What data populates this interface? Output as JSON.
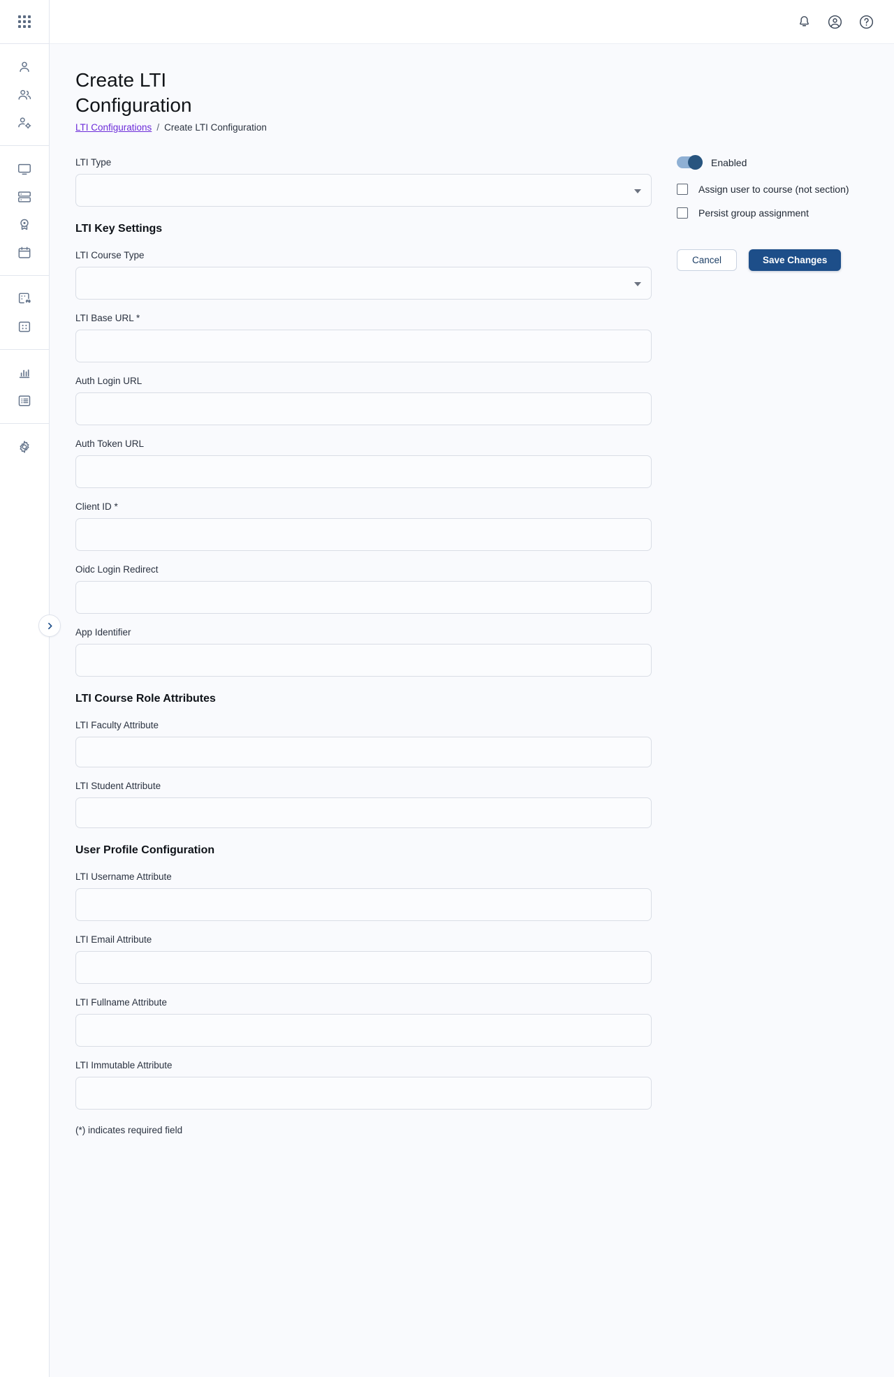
{
  "sidebar": {
    "logo_icon": "app-grid-icon",
    "groups": [
      {
        "items": [
          {
            "icon": "user-icon",
            "name": "sidebar-item-user"
          },
          {
            "icon": "users-group-icon",
            "name": "sidebar-item-groups"
          },
          {
            "icon": "user-settings-icon",
            "name": "sidebar-item-user-settings"
          }
        ]
      },
      {
        "items": [
          {
            "icon": "monitor-icon",
            "name": "sidebar-item-monitor"
          },
          {
            "icon": "server-icon",
            "name": "sidebar-item-server"
          },
          {
            "icon": "badge-award-icon",
            "name": "sidebar-item-badge"
          },
          {
            "icon": "calendar-icon",
            "name": "sidebar-item-calendar"
          }
        ]
      },
      {
        "items": [
          {
            "icon": "lti-link-icon",
            "name": "sidebar-item-lti"
          },
          {
            "icon": "grid-module-icon",
            "name": "sidebar-item-modules"
          }
        ]
      },
      {
        "items": [
          {
            "icon": "bar-chart-icon",
            "name": "sidebar-item-reports"
          },
          {
            "icon": "list-icon",
            "name": "sidebar-item-logs"
          }
        ]
      },
      {
        "items": [
          {
            "icon": "gear-icon",
            "name": "sidebar-item-settings"
          }
        ]
      }
    ],
    "collapse_icon": "chevron-right-icon"
  },
  "topbar": {
    "icons": [
      {
        "name": "notifications-bell-icon"
      },
      {
        "name": "account-circle-icon"
      },
      {
        "name": "help-circle-icon"
      }
    ]
  },
  "header": {
    "title": "Create LTI Configuration",
    "breadcrumb": {
      "link": "LTI Configurations",
      "separator": "/",
      "current": "Create LTI Configuration"
    }
  },
  "form": {
    "lti_type": {
      "label": "LTI Type",
      "value": "",
      "type": "select"
    },
    "sections": [
      {
        "heading": "LTI Key Settings",
        "fields": [
          {
            "label": "LTI Course Type",
            "value": "",
            "type": "select"
          },
          {
            "label": "LTI Base URL *",
            "value": "",
            "type": "text"
          },
          {
            "label": "Auth Login URL",
            "value": "",
            "type": "text"
          },
          {
            "label": "Auth Token URL",
            "value": "",
            "type": "text"
          },
          {
            "label": "Client ID *",
            "value": "",
            "type": "text"
          },
          {
            "label": "Oidc Login Redirect",
            "value": "",
            "type": "text"
          },
          {
            "label": "App Identifier",
            "value": "",
            "type": "text"
          }
        ]
      },
      {
        "heading": "LTI Course Role Attributes",
        "fields": [
          {
            "label": "LTI Faculty Attribute",
            "value": "",
            "type": "text"
          },
          {
            "label": "LTI Student Attribute",
            "value": "",
            "type": "text"
          }
        ]
      },
      {
        "heading": "User Profile Configuration",
        "fields": [
          {
            "label": "LTI Username Attribute",
            "value": "",
            "type": "text"
          },
          {
            "label": "LTI Email Attribute",
            "value": "",
            "type": "text"
          },
          {
            "label": "LTI Fullname Attribute",
            "value": "",
            "type": "text"
          },
          {
            "label": "LTI Immutable Attribute",
            "value": "",
            "type": "text"
          }
        ]
      }
    ],
    "required_note": "(*) indicates required field"
  },
  "side_panel": {
    "enabled_toggle": {
      "label": "Enabled",
      "on": true
    },
    "checkboxes": [
      {
        "label": "Assign user to course (not section)",
        "checked": false
      },
      {
        "label": "Persist group assignment",
        "checked": false
      }
    ],
    "cancel_label": "Cancel",
    "save_label": "Save Changes"
  },
  "colors": {
    "accent_blue": "#1d4e89",
    "toggle_track": "#8fb0d4",
    "link_purple": "#6c2bd9",
    "content_bg": "#f9fafd",
    "border": "#d9dde5"
  }
}
